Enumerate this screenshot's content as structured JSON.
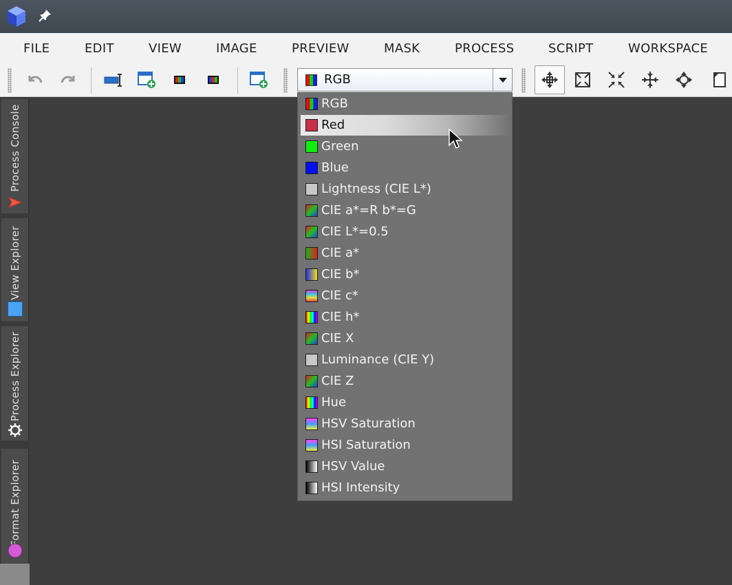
{
  "menu": [
    "FILE",
    "EDIT",
    "VIEW",
    "IMAGE",
    "PREVIEW",
    "MASK",
    "PROCESS",
    "SCRIPT",
    "WORKSPACE"
  ],
  "channel_combo": {
    "value": "RGB"
  },
  "channel_options": [
    {
      "label": "RGB",
      "icon": "rgb-swatch"
    },
    {
      "label": "Red",
      "icon": "red-swatch",
      "highlighted": true
    },
    {
      "label": "Green",
      "icon": "green-swatch"
    },
    {
      "label": "Blue",
      "icon": "blue-swatch"
    },
    {
      "label": "Lightness (CIE L*)",
      "icon": "gray-swatch"
    },
    {
      "label": "CIE a*=R b*=G",
      "icon": "cie-ab-swatch"
    },
    {
      "label": "CIE L*=0.5",
      "icon": "cie-ab-swatch"
    },
    {
      "label": "CIE a*",
      "icon": "cie-a-swatch"
    },
    {
      "label": "CIE b*",
      "icon": "cie-b-swatch"
    },
    {
      "label": "CIE c*",
      "icon": "cie-c-swatch"
    },
    {
      "label": "CIE h*",
      "icon": "hue-swatch"
    },
    {
      "label": "CIE X",
      "icon": "cie-ab-swatch"
    },
    {
      "label": "Luminance (CIE Y)",
      "icon": "gray-swatch"
    },
    {
      "label": "CIE Z",
      "icon": "cie-ab-swatch"
    },
    {
      "label": "Hue",
      "icon": "hue-swatch"
    },
    {
      "label": "HSV Saturation",
      "icon": "saturation-swatch"
    },
    {
      "label": "HSI Saturation",
      "icon": "saturation-swatch"
    },
    {
      "label": "HSV Value",
      "icon": "value-swatch"
    },
    {
      "label": "HSI Intensity",
      "icon": "value-swatch"
    }
  ],
  "side_tabs": [
    {
      "label": "Process Console",
      "icon": "send-arrow-icon"
    },
    {
      "label": "View Explorer",
      "icon": "blue-square-icon"
    },
    {
      "label": "Process Explorer",
      "icon": "gear-icon"
    },
    {
      "label": "Format Explorer",
      "icon": "magenta-circle-icon"
    }
  ],
  "colors": {
    "titlebar": "#46505a",
    "menubar": "#f2f2f2",
    "workspace": "#3e3e3e",
    "dropdown": "#727272",
    "highlight": "#e6e6e6"
  }
}
